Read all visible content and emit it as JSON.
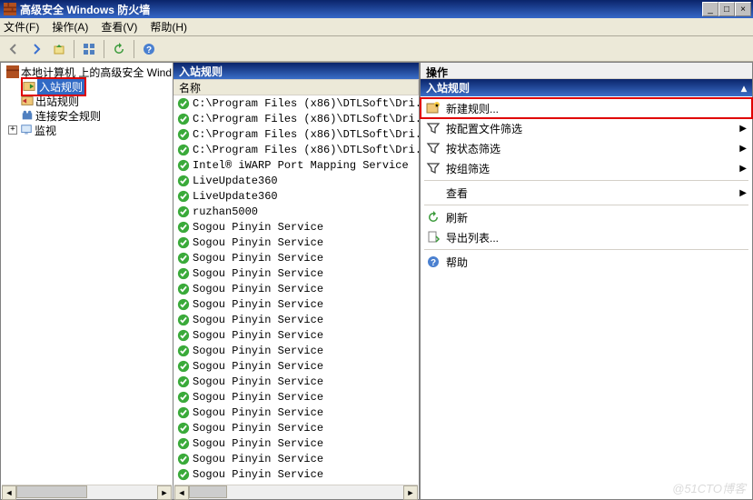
{
  "window": {
    "title": "高级安全 Windows 防火墙",
    "min": "_",
    "max": "□",
    "close": "×"
  },
  "menu": {
    "file": "文件(F)",
    "action": "操作(A)",
    "view": "查看(V)",
    "help": "帮助(H)"
  },
  "tree": {
    "root": "本地计算机 上的高级安全 Wind",
    "inbound": "入站规则",
    "outbound": "出站规则",
    "connsec": "连接安全规则",
    "monitor": "监视"
  },
  "mid": {
    "header": "入站规则",
    "col1": "名称",
    "rows": [
      "C:\\Program Files (x86)\\DTLSoft\\Dri...",
      "C:\\Program Files (x86)\\DTLSoft\\Dri...",
      "C:\\Program Files (x86)\\DTLSoft\\Dri...",
      "C:\\Program Files (x86)\\DTLSoft\\Dri...",
      "Intel® iWARP Port Mapping Service",
      "LiveUpdate360",
      "LiveUpdate360",
      "ruzhan5000",
      "Sogou Pinyin Service",
      "Sogou Pinyin Service",
      "Sogou Pinyin Service",
      "Sogou Pinyin Service",
      "Sogou Pinyin Service",
      "Sogou Pinyin Service",
      "Sogou Pinyin Service",
      "Sogou Pinyin Service",
      "Sogou Pinyin Service",
      "Sogou Pinyin Service",
      "Sogou Pinyin Service",
      "Sogou Pinyin Service",
      "Sogou Pinyin Service",
      "Sogou Pinyin Service",
      "Sogou Pinyin Service",
      "Sogou Pinyin Service",
      "Sogou Pinyin Service"
    ]
  },
  "actions": {
    "header": "操作",
    "sub": "入站规则",
    "newrule": "新建规则...",
    "filter_profile": "按配置文件筛选",
    "filter_state": "按状态筛选",
    "filter_group": "按组筛选",
    "view": "查看",
    "refresh": "刷新",
    "export": "导出列表...",
    "help": "帮助"
  },
  "watermark": "@51CTO博客"
}
